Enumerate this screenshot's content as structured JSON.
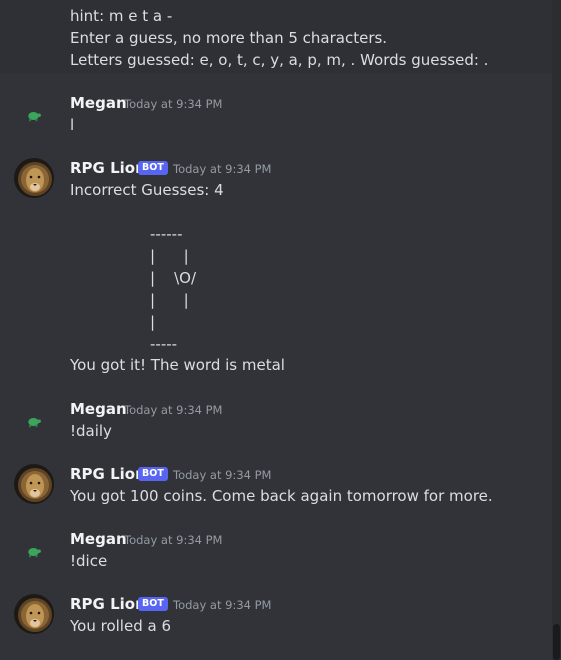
{
  "top": {
    "hint": "hint: m e t a -",
    "instruction": "Enter a guess, no more than 5 characters.",
    "guessed": "Letters guessed: e, o, t, c, y, a, p, m, . Words guessed: ."
  },
  "messages": [
    {
      "author": "Megan",
      "time": "Today at 9:34 PM",
      "text": "l"
    },
    {
      "author": "RPG Lion",
      "bot_tag": "BOT",
      "time": "Today at 9:34 PM",
      "text": "Incorrect Guesses: 4",
      "art": [
        "------",
        "|      |",
        "|    \\O/",
        "|      |",
        "|",
        "-----"
      ],
      "footer": "You got it! The word is metal"
    },
    {
      "author": "Megan",
      "time": "Today at 9:34 PM",
      "text": "!daily"
    },
    {
      "author": "RPG Lion",
      "bot_tag": "BOT",
      "time": "Today at 9:34 PM",
      "text": "You got 100 coins. Come back again tomorrow for more."
    },
    {
      "author": "Megan",
      "time": "Today at 9:34 PM",
      "text": "!dice"
    },
    {
      "author": "RPG Lion",
      "bot_tag": "BOT",
      "time": "Today at 9:34 PM",
      "text": "You rolled a 6"
    }
  ],
  "colors": {
    "background": "#313338",
    "bot_tag": "#5865f2",
    "turtle": "#3ba55d"
  },
  "icons": {
    "megan_avatar": "turtle-icon",
    "bot_avatar": "lion-avatar"
  }
}
